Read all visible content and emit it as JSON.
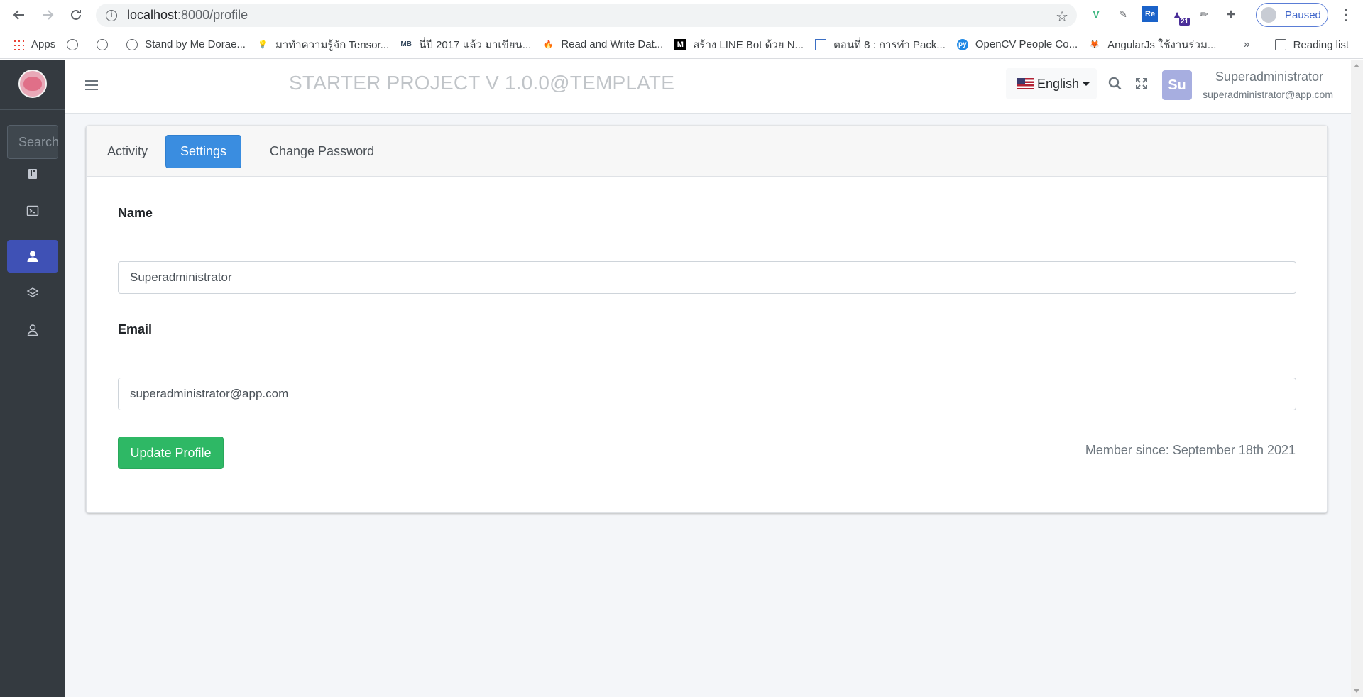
{
  "browser": {
    "url_host": "localhost",
    "url_path": ":8000/profile",
    "profile_status": "Paused",
    "extension_badge": "21",
    "bookmarks": [
      {
        "label": "Apps",
        "icon": "apps-grid-icon"
      },
      {
        "label": "",
        "icon": "globe-icon"
      },
      {
        "label": "",
        "icon": "globe-icon"
      },
      {
        "label": "Stand by Me Dorae...",
        "icon": "globe-icon"
      },
      {
        "label": "มาทำความรู้จัก Tensor...",
        "icon": "lightbulb-icon"
      },
      {
        "label": "นี่ปี 2017 แล้ว มาเขียน...",
        "icon": "mb-icon"
      },
      {
        "label": "Read and Write Dat...",
        "icon": "firebase-icon"
      },
      {
        "label": "สร้าง LINE Bot ด้วย N...",
        "icon": "medium-icon"
      },
      {
        "label": "ตอนที่ 8 : การทำ Pack...",
        "icon": "page-icon"
      },
      {
        "label": "OpenCV People Co...",
        "icon": "pyimagesearch-icon"
      },
      {
        "label": "AngularJs ใช้งานร่วม...",
        "icon": "fox-icon"
      }
    ],
    "more_bookmarks": "»",
    "reading_list": "Reading list"
  },
  "sidebar": {
    "search_placeholder": "Search",
    "items": [
      {
        "name": "dashboard",
        "icon": "book-icon",
        "active": false
      },
      {
        "name": "terminal",
        "icon": "terminal-icon",
        "active": false
      },
      {
        "name": "profile",
        "icon": "user-icon",
        "active": true
      },
      {
        "name": "layers",
        "icon": "layers-icon",
        "active": false
      },
      {
        "name": "users",
        "icon": "user-outline-icon",
        "active": false
      }
    ]
  },
  "navbar": {
    "title": "STARTER PROJECT V 1.0.0@TEMPLATE",
    "language": "English",
    "avatar_initials": "Su",
    "user_name": "Superadministrator",
    "user_email": "superadministrator@app.com"
  },
  "profile": {
    "tabs": [
      {
        "label": "Activity",
        "active": false
      },
      {
        "label": "Settings",
        "active": true
      },
      {
        "label": "Change Password",
        "active": false
      }
    ],
    "name_label": "Name",
    "name_value": "Superadministrator",
    "email_label": "Email",
    "email_value": "superadministrator@app.com",
    "update_button": "Update Profile",
    "member_since": "Member since: September 18th 2021"
  },
  "colors": {
    "sidebar_bg": "#343a40",
    "active_item": "#3f51b5",
    "tab_active": "#3a8de0",
    "button_success": "#2eb865"
  }
}
